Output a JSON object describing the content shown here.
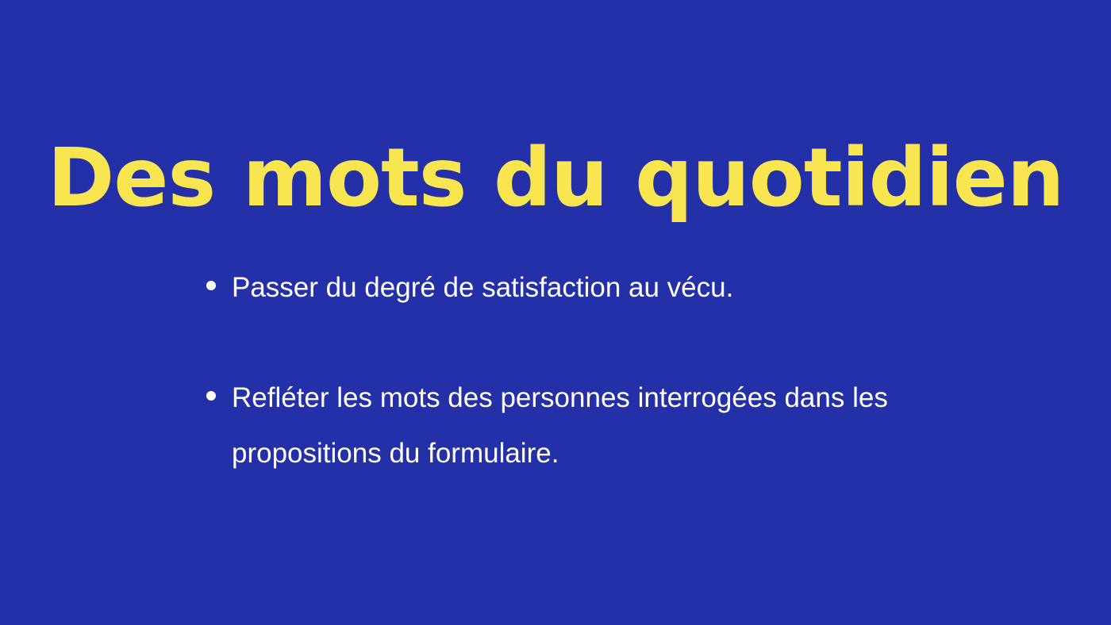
{
  "slide": {
    "title": "Des mots du quotidien",
    "bullets": [
      {
        "text": "Passer du degré de satisfaction au vécu."
      },
      {
        "text": "Refléter les mots des personnes interrogées dans les propositions du formulaire."
      }
    ]
  },
  "colors": {
    "background": "#2330a8",
    "title": "#f8e54f",
    "body_text": "#ffffff"
  }
}
